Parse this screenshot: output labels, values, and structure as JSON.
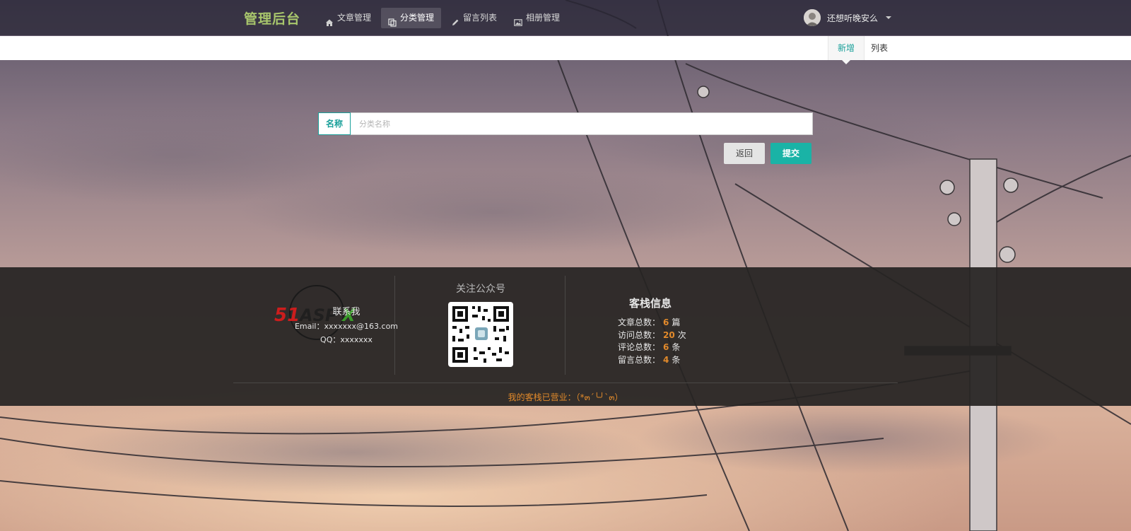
{
  "header": {
    "brand": "管理后台",
    "nav": [
      {
        "label": "文章管理",
        "icon": "home-icon",
        "active": false
      },
      {
        "label": "分类管理",
        "icon": "copy-icon",
        "active": true
      },
      {
        "label": "留言列表",
        "icon": "pencil-icon",
        "active": false
      },
      {
        "label": "相册管理",
        "icon": "picture-icon",
        "active": false
      }
    ],
    "user": {
      "name": "还想听晚安么",
      "avatar_icon": "user-avatar-icon",
      "menu_icon": "caret-down-icon"
    }
  },
  "subtabs": [
    {
      "label": "新增",
      "active": true
    },
    {
      "label": "列表",
      "active": false
    }
  ],
  "form": {
    "name_label": "名称",
    "name_value": "",
    "name_placeholder": "分类名称",
    "back_label": "返回",
    "submit_label": "提交"
  },
  "footer": {
    "contact": {
      "title": "联系我",
      "email": "Email：xxxxxxx@163.com",
      "qq": "QQ：xxxxxxx",
      "watermark": "51ASPX"
    },
    "qrcode": {
      "title": "关注公众号",
      "icon": "qr-code-icon"
    },
    "stats": {
      "title": "客栈信息",
      "items": [
        {
          "label": "文章总数：",
          "value": "6",
          "unit": "篇"
        },
        {
          "label": "访问总数：",
          "value": "20",
          "unit": "次"
        },
        {
          "label": "评论总数：",
          "value": "6",
          "unit": "条"
        },
        {
          "label": "留言总数：",
          "value": "4",
          "unit": "条"
        }
      ]
    },
    "note": "我的客栈已营业：（*๓´╰╯`๓）"
  },
  "colors": {
    "brand": "#a8c66c",
    "accent": "#1aa09a",
    "submit": "#1ab3a6",
    "stat_number": "#e28a2b"
  }
}
